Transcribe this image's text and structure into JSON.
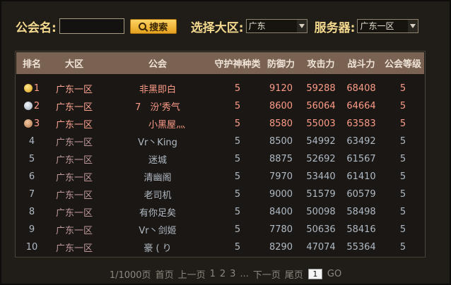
{
  "toolbar": {
    "guild_name_label": "公会名:",
    "guild_name_value": "",
    "search_label": "搜索",
    "region_label": "选择大区:",
    "region_value": "广东",
    "server_label": "服务器:",
    "server_value": "广东一区"
  },
  "table": {
    "headers": [
      "排名",
      "大区",
      "公会",
      "守护神种类",
      "防御力",
      "攻击力",
      "战斗力",
      "公会等级"
    ],
    "rows": [
      {
        "rank": "1",
        "medal": "gold",
        "region": "广东一区",
        "guild": "非黑即白",
        "guardian": "5",
        "defense": "9120",
        "attack": "59288",
        "power": "68408",
        "level": "5"
      },
      {
        "rank": "2",
        "medal": "silver",
        "region": "广东一区",
        "guild": "7　汾'秀气",
        "guardian": "5",
        "defense": "8600",
        "attack": "56064",
        "power": "64664",
        "level": "5"
      },
      {
        "rank": "3",
        "medal": "bronze",
        "region": "广东一区",
        "guild": "　　小黑屋灬",
        "guardian": "5",
        "defense": "8580",
        "attack": "55003",
        "power": "63583",
        "level": "5"
      },
      {
        "rank": "4",
        "medal": "",
        "region": "广东一区",
        "guild": "Vr丶King",
        "guardian": "5",
        "defense": "8500",
        "attack": "54992",
        "power": "63492",
        "level": "5"
      },
      {
        "rank": "5",
        "medal": "",
        "region": "广东一区",
        "guild": "迷城",
        "guardian": "5",
        "defense": "8875",
        "attack": "52692",
        "power": "61567",
        "level": "5"
      },
      {
        "rank": "6",
        "medal": "",
        "region": "广东一区",
        "guild": "清幽阁",
        "guardian": "5",
        "defense": "7970",
        "attack": "53440",
        "power": "61410",
        "level": "5"
      },
      {
        "rank": "7",
        "medal": "",
        "region": "广东一区",
        "guild": "老司机",
        "guardian": "5",
        "defense": "9000",
        "attack": "51579",
        "power": "60579",
        "level": "5"
      },
      {
        "rank": "8",
        "medal": "",
        "region": "广东一区",
        "guild": "有你足矣",
        "guardian": "5",
        "defense": "8400",
        "attack": "50098",
        "power": "58498",
        "level": "5"
      },
      {
        "rank": "9",
        "medal": "",
        "region": "广东一区",
        "guild": "Vr丶剑姬",
        "guardian": "5",
        "defense": "7780",
        "attack": "50636",
        "power": "58416",
        "level": "5"
      },
      {
        "rank": "10",
        "medal": "",
        "region": "广东一区",
        "guild": "豪 ( り",
        "guardian": "5",
        "defense": "8290",
        "attack": "47074",
        "power": "55364",
        "level": "5"
      }
    ]
  },
  "pager": {
    "page_info": "1/1000页",
    "first": "首页",
    "prev": "上一页",
    "pages": [
      "1",
      "2",
      "3"
    ],
    "ellipsis": "...",
    "next": "下一页",
    "last": "尾页",
    "input_value": "1",
    "go": "GO"
  },
  "colors": {
    "title_gold": "#f3d98e",
    "header_bg": "#7a6253",
    "top_rank_text": "#ff9c88",
    "normal_text": "#b0bac4"
  }
}
